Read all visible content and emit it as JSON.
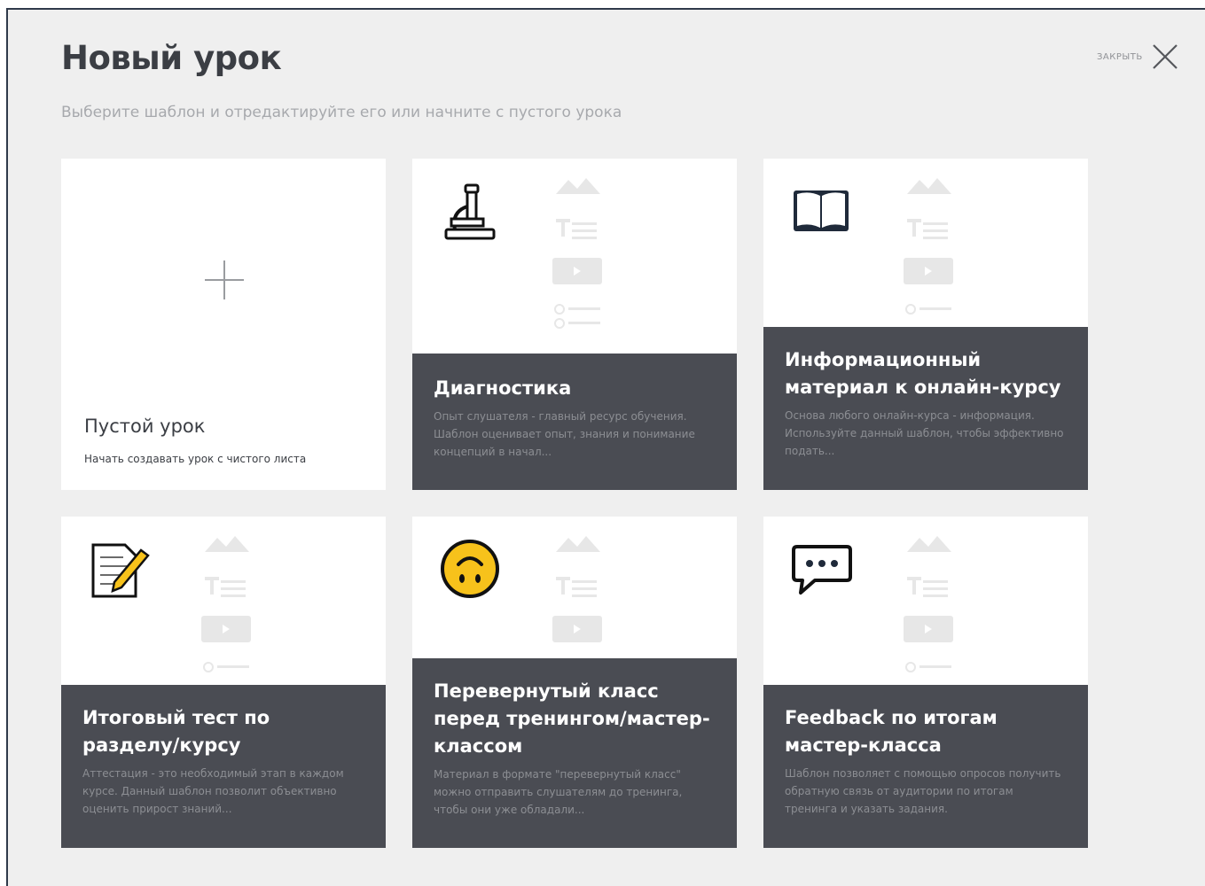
{
  "dialog": {
    "title": "Новый урок",
    "subtitle": "Выберите шаблон и отредактируйте его или начните с пустого урока",
    "close_label": "ЗАКРЫТЬ"
  },
  "cards": [
    {
      "title": "Пустой урок",
      "description": "Начать создавать урок с чистого листа",
      "icon": "plus-icon"
    },
    {
      "title": "Диагностика",
      "description": "Опыт слушателя - главный ресурс обучения. Шаблон оценивает опыт, знания и понимание концепций в начал...",
      "icon": "microscope-icon"
    },
    {
      "title": "Информационный материал к онлайн-курсу",
      "description": "Основа любого онлайн-курса - информация. Используйте данный шаблон, чтобы эффективно подать...",
      "icon": "book-icon"
    },
    {
      "title": "Итоговый тест по разделу/курсу",
      "description": "Аттестация - это необходимый этап в каждом курсе. Данный шаблон позволит объективно оценить прирост знаний...",
      "icon": "memo-icon"
    },
    {
      "title": "Перевернутый класс перед тренингом/мастер-классом",
      "description": "Материал в формате \"перевернутый класс\" можно отправить слушателям до тренинга, чтобы они уже обладали...",
      "icon": "upside-down-face-icon"
    },
    {
      "title": "Feedback по итогам мастер-класса",
      "description": "Шаблон позволяет с помощью опросов получить обратную связь от аудитории по итогам тренинга и указать задания.",
      "icon": "speech-bubble-icon"
    }
  ],
  "colors": {
    "panel": "#4a4c53",
    "background": "#efefef",
    "accent_yellow": "#f7c21b"
  }
}
